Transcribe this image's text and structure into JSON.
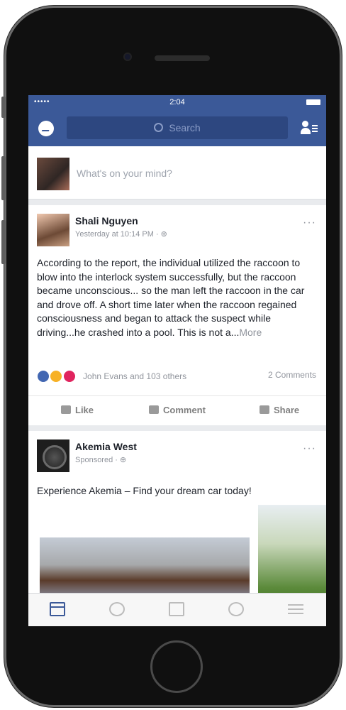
{
  "status_bar": {
    "signal": "•••••",
    "time": "2:04"
  },
  "nav": {
    "search_placeholder": "Search"
  },
  "composer": {
    "placeholder": "What's on your mind?"
  },
  "posts": [
    {
      "author": "Shali Nguyen",
      "meta": "Yesterday at 10:14 PM · ⊕",
      "text": "According to the report, the individual utilized the raccoon to blow into the interlock system successfully, but the raccoon became unconscious... so the man left the raccoon in the car and drove off. A short time later when the raccoon regained consciousness and began to attack the suspect while driving...he crashed into a pool. This is not a...",
      "more": "More",
      "reactions": "John Evans and 103 others",
      "comments": "2 Comments",
      "actions": {
        "like": "Like",
        "comment": "Comment",
        "share": "Share"
      },
      "menu_dots": "···"
    },
    {
      "author": "Akemia West",
      "meta": "Sponsored · ⊕",
      "text": "Experience Akemia – Find your dream car today!",
      "menu_dots": "···"
    }
  ],
  "colors": {
    "brand": "#3b5998",
    "like": "#4267b2",
    "love": "#e0245e",
    "haha": "#f7b125"
  },
  "tabs": [
    "news-feed-icon",
    "video-icon",
    "marketplace-icon",
    "notifications-icon",
    "menu-icon"
  ]
}
